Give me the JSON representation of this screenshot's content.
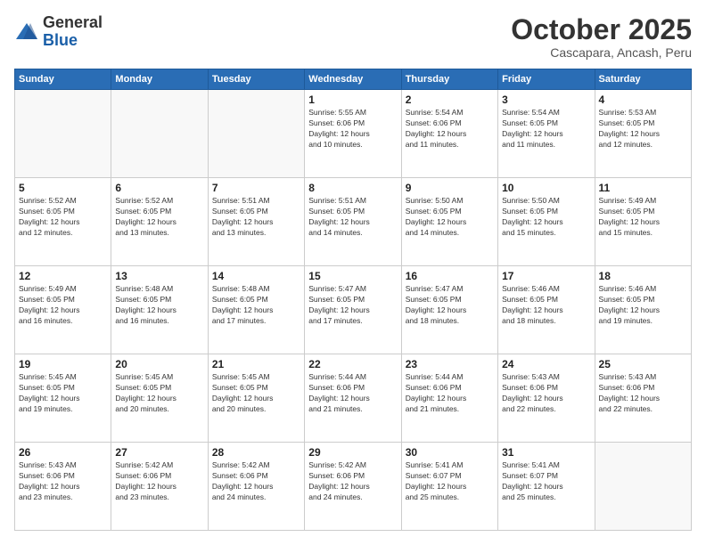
{
  "logo": {
    "general": "General",
    "blue": "Blue"
  },
  "header": {
    "month": "October 2025",
    "location": "Cascapara, Ancash, Peru"
  },
  "weekdays": [
    "Sunday",
    "Monday",
    "Tuesday",
    "Wednesday",
    "Thursday",
    "Friday",
    "Saturday"
  ],
  "weeks": [
    [
      {
        "day": "",
        "info": ""
      },
      {
        "day": "",
        "info": ""
      },
      {
        "day": "",
        "info": ""
      },
      {
        "day": "1",
        "info": "Sunrise: 5:55 AM\nSunset: 6:06 PM\nDaylight: 12 hours\nand 10 minutes."
      },
      {
        "day": "2",
        "info": "Sunrise: 5:54 AM\nSunset: 6:06 PM\nDaylight: 12 hours\nand 11 minutes."
      },
      {
        "day": "3",
        "info": "Sunrise: 5:54 AM\nSunset: 6:05 PM\nDaylight: 12 hours\nand 11 minutes."
      },
      {
        "day": "4",
        "info": "Sunrise: 5:53 AM\nSunset: 6:05 PM\nDaylight: 12 hours\nand 12 minutes."
      }
    ],
    [
      {
        "day": "5",
        "info": "Sunrise: 5:52 AM\nSunset: 6:05 PM\nDaylight: 12 hours\nand 12 minutes."
      },
      {
        "day": "6",
        "info": "Sunrise: 5:52 AM\nSunset: 6:05 PM\nDaylight: 12 hours\nand 13 minutes."
      },
      {
        "day": "7",
        "info": "Sunrise: 5:51 AM\nSunset: 6:05 PM\nDaylight: 12 hours\nand 13 minutes."
      },
      {
        "day": "8",
        "info": "Sunrise: 5:51 AM\nSunset: 6:05 PM\nDaylight: 12 hours\nand 14 minutes."
      },
      {
        "day": "9",
        "info": "Sunrise: 5:50 AM\nSunset: 6:05 PM\nDaylight: 12 hours\nand 14 minutes."
      },
      {
        "day": "10",
        "info": "Sunrise: 5:50 AM\nSunset: 6:05 PM\nDaylight: 12 hours\nand 15 minutes."
      },
      {
        "day": "11",
        "info": "Sunrise: 5:49 AM\nSunset: 6:05 PM\nDaylight: 12 hours\nand 15 minutes."
      }
    ],
    [
      {
        "day": "12",
        "info": "Sunrise: 5:49 AM\nSunset: 6:05 PM\nDaylight: 12 hours\nand 16 minutes."
      },
      {
        "day": "13",
        "info": "Sunrise: 5:48 AM\nSunset: 6:05 PM\nDaylight: 12 hours\nand 16 minutes."
      },
      {
        "day": "14",
        "info": "Sunrise: 5:48 AM\nSunset: 6:05 PM\nDaylight: 12 hours\nand 17 minutes."
      },
      {
        "day": "15",
        "info": "Sunrise: 5:47 AM\nSunset: 6:05 PM\nDaylight: 12 hours\nand 17 minutes."
      },
      {
        "day": "16",
        "info": "Sunrise: 5:47 AM\nSunset: 6:05 PM\nDaylight: 12 hours\nand 18 minutes."
      },
      {
        "day": "17",
        "info": "Sunrise: 5:46 AM\nSunset: 6:05 PM\nDaylight: 12 hours\nand 18 minutes."
      },
      {
        "day": "18",
        "info": "Sunrise: 5:46 AM\nSunset: 6:05 PM\nDaylight: 12 hours\nand 19 minutes."
      }
    ],
    [
      {
        "day": "19",
        "info": "Sunrise: 5:45 AM\nSunset: 6:05 PM\nDaylight: 12 hours\nand 19 minutes."
      },
      {
        "day": "20",
        "info": "Sunrise: 5:45 AM\nSunset: 6:05 PM\nDaylight: 12 hours\nand 20 minutes."
      },
      {
        "day": "21",
        "info": "Sunrise: 5:45 AM\nSunset: 6:05 PM\nDaylight: 12 hours\nand 20 minutes."
      },
      {
        "day": "22",
        "info": "Sunrise: 5:44 AM\nSunset: 6:06 PM\nDaylight: 12 hours\nand 21 minutes."
      },
      {
        "day": "23",
        "info": "Sunrise: 5:44 AM\nSunset: 6:06 PM\nDaylight: 12 hours\nand 21 minutes."
      },
      {
        "day": "24",
        "info": "Sunrise: 5:43 AM\nSunset: 6:06 PM\nDaylight: 12 hours\nand 22 minutes."
      },
      {
        "day": "25",
        "info": "Sunrise: 5:43 AM\nSunset: 6:06 PM\nDaylight: 12 hours\nand 22 minutes."
      }
    ],
    [
      {
        "day": "26",
        "info": "Sunrise: 5:43 AM\nSunset: 6:06 PM\nDaylight: 12 hours\nand 23 minutes."
      },
      {
        "day": "27",
        "info": "Sunrise: 5:42 AM\nSunset: 6:06 PM\nDaylight: 12 hours\nand 23 minutes."
      },
      {
        "day": "28",
        "info": "Sunrise: 5:42 AM\nSunset: 6:06 PM\nDaylight: 12 hours\nand 24 minutes."
      },
      {
        "day": "29",
        "info": "Sunrise: 5:42 AM\nSunset: 6:06 PM\nDaylight: 12 hours\nand 24 minutes."
      },
      {
        "day": "30",
        "info": "Sunrise: 5:41 AM\nSunset: 6:07 PM\nDaylight: 12 hours\nand 25 minutes."
      },
      {
        "day": "31",
        "info": "Sunrise: 5:41 AM\nSunset: 6:07 PM\nDaylight: 12 hours\nand 25 minutes."
      },
      {
        "day": "",
        "info": ""
      }
    ]
  ]
}
